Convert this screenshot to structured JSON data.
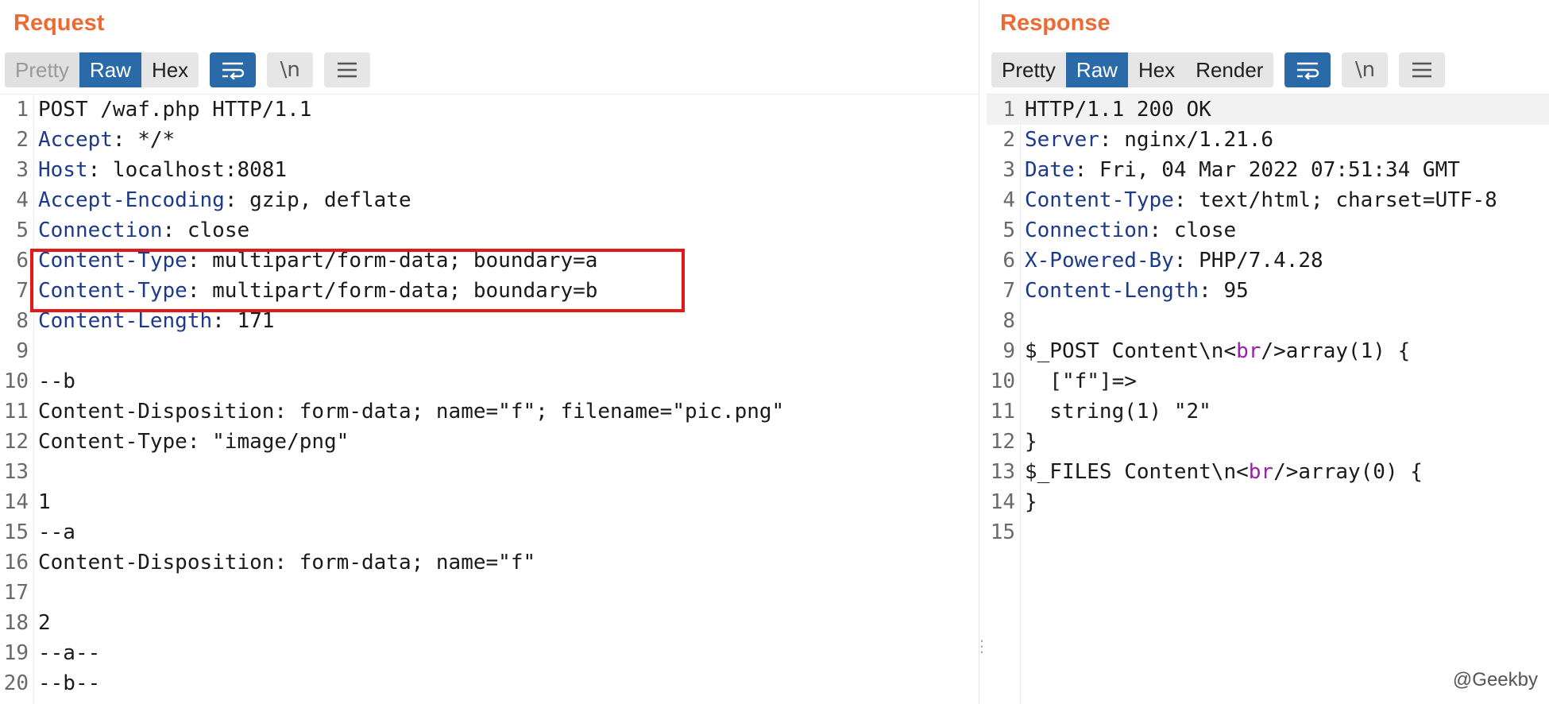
{
  "request": {
    "title": "Request",
    "tabs": [
      {
        "label": "Pretty",
        "state": "disabled"
      },
      {
        "label": "Raw",
        "state": "active"
      },
      {
        "label": "Hex",
        "state": "normal"
      }
    ],
    "icons": [
      "wrap-lines-icon",
      "newline-icon",
      "menu-icon"
    ],
    "newline_label": "\\n",
    "lines": [
      {
        "n": "1",
        "key": "",
        "rest": "POST /waf.php HTTP/1.1"
      },
      {
        "n": "2",
        "key": "Accept",
        "rest": ": */*"
      },
      {
        "n": "3",
        "key": "Host",
        "rest": ": localhost:8081"
      },
      {
        "n": "4",
        "key": "Accept-Encoding",
        "rest": ": gzip, deflate"
      },
      {
        "n": "5",
        "key": "Connection",
        "rest": ": close"
      },
      {
        "n": "6",
        "key": "Content-Type",
        "rest": ": multipart/form-data; boundary=a"
      },
      {
        "n": "7",
        "key": "Content-Type",
        "rest": ": multipart/form-data; boundary=b"
      },
      {
        "n": "8",
        "key": "Content-Length",
        "rest": ": 171"
      },
      {
        "n": "9",
        "key": "",
        "rest": ""
      },
      {
        "n": "10",
        "key": "",
        "rest": "--b"
      },
      {
        "n": "11",
        "key": "",
        "rest": "Content-Disposition: form-data; name=\"f\"; filename=\"pic.png\""
      },
      {
        "n": "12",
        "key": "",
        "rest": "Content-Type: \"image/png\""
      },
      {
        "n": "13",
        "key": "",
        "rest": ""
      },
      {
        "n": "14",
        "key": "",
        "rest": "1"
      },
      {
        "n": "15",
        "key": "",
        "rest": "--a"
      },
      {
        "n": "16",
        "key": "",
        "rest": "Content-Disposition: form-data; name=\"f\""
      },
      {
        "n": "17",
        "key": "",
        "rest": ""
      },
      {
        "n": "18",
        "key": "",
        "rest": "2"
      },
      {
        "n": "19",
        "key": "",
        "rest": "--a--"
      },
      {
        "n": "20",
        "key": "",
        "rest": "--b--"
      }
    ]
  },
  "response": {
    "title": "Response",
    "tabs": [
      {
        "label": "Pretty",
        "state": "normal"
      },
      {
        "label": "Raw",
        "state": "active"
      },
      {
        "label": "Hex",
        "state": "normal"
      },
      {
        "label": "Render",
        "state": "normal"
      }
    ],
    "newline_label": "\\n",
    "lines": [
      {
        "n": "1",
        "key": "",
        "rest": "HTTP/1.1 200 OK"
      },
      {
        "n": "2",
        "key": "Server",
        "rest": ": nginx/1.21.6"
      },
      {
        "n": "3",
        "key": "Date",
        "rest": ": Fri, 04 Mar 2022 07:51:34 GMT"
      },
      {
        "n": "4",
        "key": "Content-Type",
        "rest": ": text/html; charset=UTF-8"
      },
      {
        "n": "5",
        "key": "Connection",
        "rest": ": close"
      },
      {
        "n": "6",
        "key": "X-Powered-By",
        "rest": ": PHP/7.4.28"
      },
      {
        "n": "7",
        "key": "Content-Length",
        "rest": ": 95"
      },
      {
        "n": "8",
        "key": "",
        "rest": ""
      },
      {
        "n": "9",
        "key": "",
        "rest": "$_POST Content\\n<",
        "tag": "br",
        "after": "/>array(1) {"
      },
      {
        "n": "10",
        "key": "",
        "rest": "  [\"f\"]=>"
      },
      {
        "n": "11",
        "key": "",
        "rest": "  string(1) \"2\""
      },
      {
        "n": "12",
        "key": "",
        "rest": "}"
      },
      {
        "n": "13",
        "key": "",
        "rest": "$_FILES Content\\n<",
        "tag": "br",
        "after": "/>array(0) {"
      },
      {
        "n": "14",
        "key": "",
        "rest": "}"
      },
      {
        "n": "15",
        "key": "",
        "rest": ""
      }
    ]
  },
  "watermark": "@Geekby",
  "colors": {
    "title": "#ec6a34",
    "active_tab": "#2a6aa8",
    "header_key": "#1d3a8a",
    "tag": "#9a1fa8",
    "highlight_border": "#e31919"
  }
}
